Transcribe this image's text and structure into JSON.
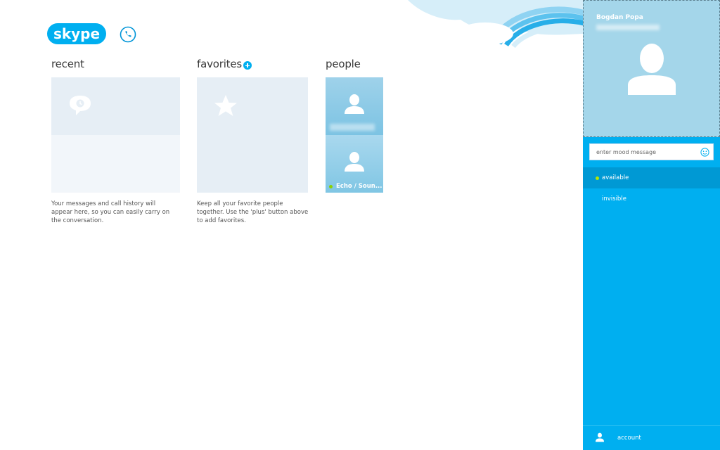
{
  "app": {
    "logo_text": "skype"
  },
  "sections": {
    "recent": {
      "title": "recent",
      "hint": "Your messages and call history will appear here, so you can easily carry on the conversation."
    },
    "favorites": {
      "title": "favorites",
      "hint": "Keep all your favorite people together. Use the 'plus' button above to add favorites."
    },
    "people": {
      "title": "people",
      "contacts": [
        {
          "name": ""
        },
        {
          "name": "Echo / Soun...",
          "status": "online"
        }
      ]
    }
  },
  "panel": {
    "user_name": "Bogdan Popa",
    "mood_placeholder": "enter mood message",
    "statuses": [
      {
        "label": "available",
        "selected": true
      },
      {
        "label": "invisible",
        "selected": false
      }
    ],
    "account_label": "account"
  },
  "colors": {
    "accent": "#00aff0",
    "selected_status": "#0099d4",
    "online": "#8dd100"
  }
}
